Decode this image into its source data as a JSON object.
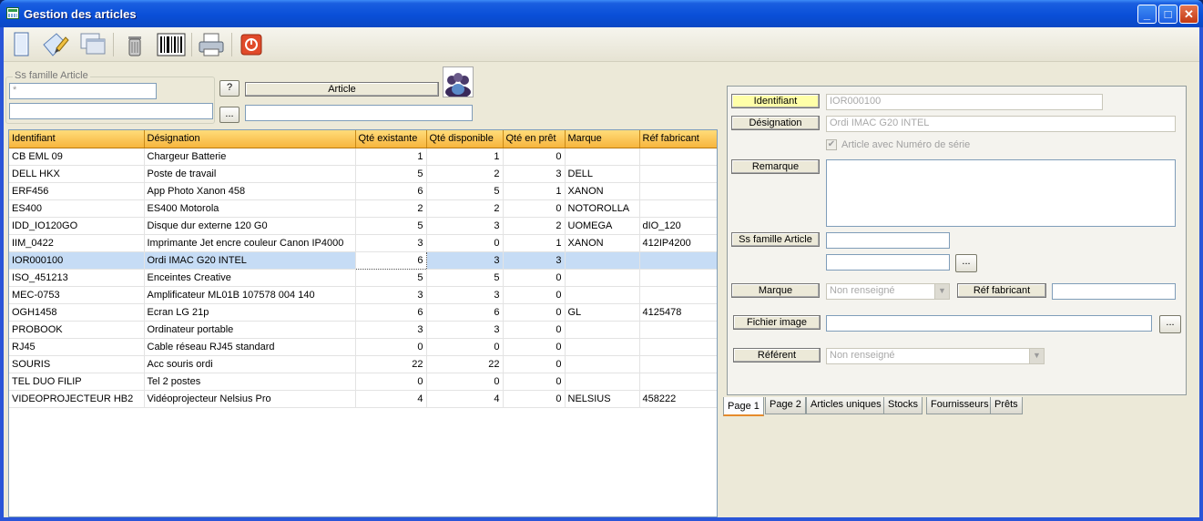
{
  "window": {
    "title": "Gestion des articles",
    "minimize": "_",
    "maximize": "□",
    "close": "✕"
  },
  "filter": {
    "group_label": "Ss famille Article",
    "ssfamille_value": "*",
    "ssfamille_desc": "",
    "help_button": "?",
    "browse_button": "...",
    "article_button": "Article",
    "article_search": ""
  },
  "table": {
    "columns": [
      "Identifiant",
      "Désignation",
      "Qté existante",
      "Qté disponible",
      "Qté en prêt",
      "Marque",
      "Réf fabricant"
    ],
    "rows": [
      [
        "CB EML 09",
        "Chargeur Batterie",
        "1",
        "1",
        "0",
        "",
        ""
      ],
      [
        "DELL HKX",
        "Poste de travail",
        "5",
        "2",
        "3",
        "DELL",
        ""
      ],
      [
        "ERF456",
        "App Photo Xanon 458",
        "6",
        "5",
        "1",
        "XANON",
        ""
      ],
      [
        "ES400",
        "ES400 Motorola",
        "2",
        "2",
        "0",
        "NOTOROLLA",
        ""
      ],
      [
        "IDD_IO120GO",
        "Disque dur externe 120 G0",
        "5",
        "3",
        "2",
        "UOMEGA",
        "dIO_120"
      ],
      [
        "IIM_0422",
        "Imprimante Jet encre couleur Canon IP4000",
        "3",
        "0",
        "1",
        "XANON",
        "412IP4200"
      ],
      [
        "IOR000100",
        "Ordi IMAC G20 INTEL",
        "6",
        "3",
        "3",
        "",
        ""
      ],
      [
        "ISO_451213",
        "Enceintes Creative",
        "5",
        "5",
        "0",
        "",
        ""
      ],
      [
        "MEC-0753",
        "Amplificateur ML01B 107578 004 140",
        "3",
        "3",
        "0",
        "",
        ""
      ],
      [
        "OGH1458",
        "Ecran LG 21p",
        "6",
        "6",
        "0",
        "GL",
        "4125478"
      ],
      [
        "PROBOOK",
        "Ordinateur portable",
        "3",
        "3",
        "0",
        "",
        ""
      ],
      [
        "RJ45",
        "Cable réseau RJ45 standard",
        "0",
        "0",
        "0",
        "",
        ""
      ],
      [
        "SOURIS",
        "Acc souris ordi",
        "22",
        "22",
        "0",
        "",
        ""
      ],
      [
        "TEL DUO FILIP",
        "Tel 2 postes",
        "0",
        "0",
        "0",
        "",
        ""
      ],
      [
        "VIDEOPROJECTEUR HB2",
        "Vidéoprojecteur Nelsius Pro",
        "4",
        "4",
        "0",
        "NELSIUS",
        "458222"
      ]
    ],
    "selected_index": 6
  },
  "detail": {
    "identifiant_label": "Identifiant",
    "identifiant_value": "IOR000100",
    "designation_label": "Désignation",
    "designation_value": "Ordi IMAC G20 INTEL",
    "serial_checkbox_label": "Article avec Numéro de série",
    "serial_checked": true,
    "remarque_label": "Remarque",
    "remarque_value": "",
    "ssfamille_label": "Ss famille Article",
    "ssfamille_code": "",
    "ssfamille_desc": "",
    "browse_button": "...",
    "marque_label": "Marque",
    "marque_value": "Non renseigné",
    "ref_fabricant_label": "Réf fabricant",
    "ref_fabricant_value": "",
    "fichier_image_label": "Fichier image",
    "fichier_image_value": "",
    "referent_label": "Référent",
    "referent_value": "Non renseigné"
  },
  "tabs": [
    "Page 1",
    "Page 2",
    "Articles uniques",
    "Stocks",
    "Fournisseurs",
    "Prêts"
  ],
  "active_tab": "Page 1",
  "icons": [
    "new-icon",
    "edit-icon",
    "duplicate-icon",
    "delete-icon",
    "barcode-icon",
    "print-icon",
    "quit-icon",
    "users-icon"
  ]
}
